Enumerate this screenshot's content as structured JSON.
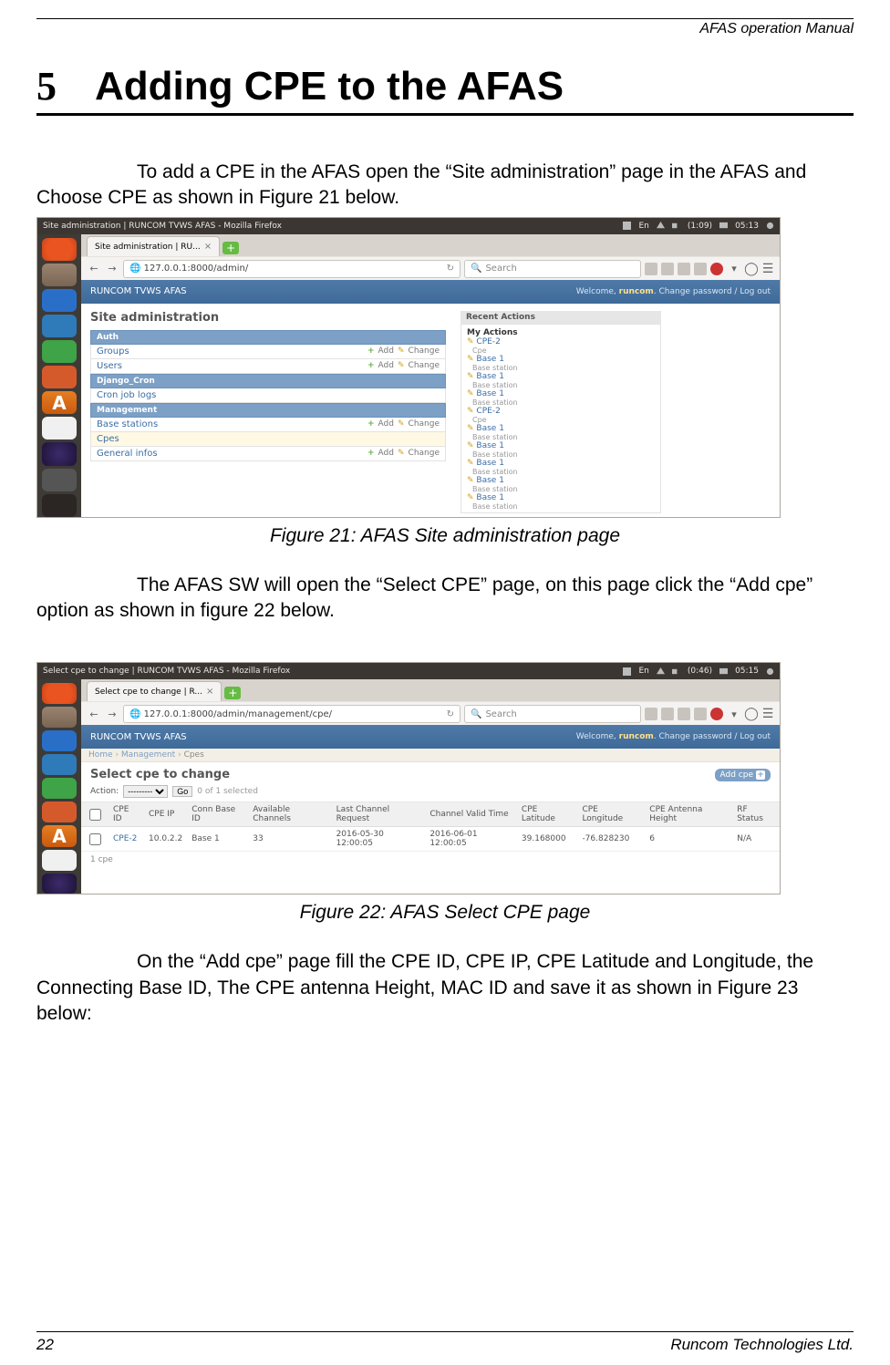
{
  "header": "AFAS operation Manual",
  "chapter_num": "5",
  "chapter_title": "Adding CPE to the AFAS",
  "para1": "To add a CPE in the AFAS open the “Site administration” page in the AFAS and Choose CPE as shown in Figure 21 below.",
  "caption1": "Figure 21:  AFAS Site administration page",
  "para2": "The AFAS SW will open the “Select CPE” page, on this page click the “Add cpe” option as shown in figure 22 below.",
  "caption2": "Figure 22: AFAS Select CPE page",
  "para3": "On the “Add cpe” page fill the CPE ID, CPE IP, CPE Latitude and Longitude, the Connecting Base ID, The CPE antenna Height, MAC ID and save it as shown in Figure 23 below:",
  "footer_page": "22",
  "footer_company": "Runcom Technologies Ltd.",
  "fig21": {
    "window_title": "Site administration | RUNCOM TVWS AFAS - Mozilla Firefox",
    "tab_label": "Site administration | RU...",
    "url": "127.0.0.1:8000/admin/",
    "search_placeholder": "Search",
    "clock": "05:13",
    "icons_info": "(1:09)",
    "brand": "RUNCOM TVWS AFAS",
    "welcome": "Welcome,",
    "user": "runcom",
    "links": "Change password / Log out",
    "admin_title": "Site administration",
    "apps": [
      {
        "name": "Auth",
        "models": [
          "Groups",
          "Users"
        ]
      },
      {
        "name": "Django_Cron",
        "models": [
          "Cron job logs"
        ]
      },
      {
        "name": "Management",
        "models": [
          "Base stations",
          "Cpes",
          "General infos"
        ]
      }
    ],
    "add": "Add",
    "change": "Change",
    "recent_header": "Recent Actions",
    "myactions": "My Actions",
    "recent": [
      {
        "t": "CPE-2",
        "s": "Cpe"
      },
      {
        "t": "Base 1",
        "s": "Base station"
      },
      {
        "t": "Base 1",
        "s": "Base station"
      },
      {
        "t": "Base 1",
        "s": "Base station"
      },
      {
        "t": "CPE-2",
        "s": "Cpe"
      },
      {
        "t": "Base 1",
        "s": "Base station"
      },
      {
        "t": "Base 1",
        "s": "Base station"
      },
      {
        "t": "Base 1",
        "s": "Base station"
      },
      {
        "t": "Base 1",
        "s": "Base station"
      },
      {
        "t": "Base 1",
        "s": "Base station"
      }
    ]
  },
  "fig22": {
    "window_title": "Select cpe to change | RUNCOM TVWS AFAS - Mozilla Firefox",
    "tab_label": "Select cpe to change | R...",
    "url": "127.0.0.1:8000/admin/management/cpe/",
    "search_placeholder": "Search",
    "clock": "05:15",
    "icons_info": "(0:46)",
    "brand": "RUNCOM TVWS AFAS",
    "welcome": "Welcome,",
    "user": "runcom",
    "links": "Change password / Log out",
    "breadcrumb": [
      "Home",
      "Management",
      "Cpes"
    ],
    "sel_title": "Select cpe to change",
    "add_label": "Add cpe",
    "action_label": "Action:",
    "action_placeholder": "---------",
    "go": "Go",
    "sel_count": "0 of 1 selected",
    "columns": [
      "CPE ID",
      "CPE IP",
      "Conn Base ID",
      "Available Channels",
      "Last Channel Request",
      "Channel Valid Time",
      "CPE Latitude",
      "CPE Longitude",
      "CPE Antenna Height",
      "RF Status"
    ],
    "row": [
      "CPE-2",
      "10.0.2.2",
      "Base 1",
      "33",
      "2016-05-30 12:00:05",
      "2016-06-01 12:00:05",
      "39.168000",
      "-76.828230",
      "6",
      "N/A"
    ],
    "count": "1 cpe"
  }
}
